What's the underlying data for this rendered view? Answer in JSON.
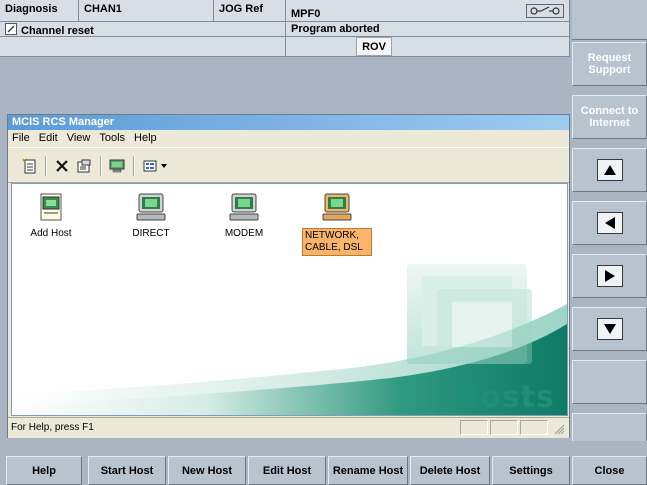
{
  "status": {
    "area": "Diagnosis",
    "channel": "CHAN1",
    "mode": "JOG Ref",
    "program": "MPF0",
    "channel_status": "Channel reset",
    "program_status": "Program aborted",
    "override": "ROV"
  },
  "right_softkeys": {
    "request_support": "Request Support",
    "connect_internet": "Connect to Internet"
  },
  "window": {
    "title": "MCIS RCS Manager",
    "menu": [
      "File",
      "Edit",
      "View",
      "Tools",
      "Help"
    ],
    "hosts": [
      {
        "label": "Add Host",
        "icon": "add-host-icon"
      },
      {
        "label": "DIRECT",
        "icon": "computer-icon"
      },
      {
        "label": "MODEM",
        "icon": "computer-icon"
      },
      {
        "label": "NETWORK, CABLE, DSL",
        "icon": "computer-icon"
      }
    ],
    "watermark": "Hosts",
    "status_text": "For Help, press F1"
  },
  "bottom_softkeys": [
    "Help",
    "Start Host",
    "New Host",
    "Edit Host",
    "Rename Host",
    "Delete Host",
    "Settings",
    "Close"
  ],
  "colors": {
    "panel_bg": "#a9b5c3",
    "softkey_bg": "#b8c3d0",
    "title_blue": "#5b9bd7",
    "watermark_green": "#2e9a82",
    "selection_orange": "#f7b46a"
  }
}
